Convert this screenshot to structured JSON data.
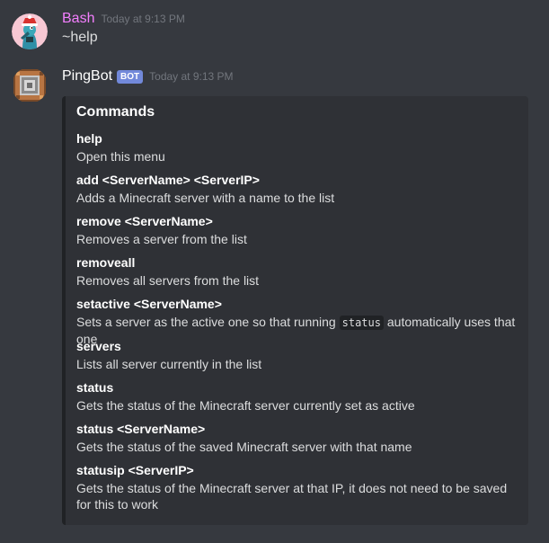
{
  "messages": [
    {
      "username": "Bash",
      "username_color": "#f47fff",
      "timestamp": "Today at 9:13 PM",
      "text": "~help"
    },
    {
      "username": "PingBot",
      "username_color": "#ffffff",
      "bot_tag": "BOT",
      "timestamp": "Today at 9:13 PM"
    }
  ],
  "embed": {
    "title": "Commands",
    "fields": [
      {
        "name": "help",
        "value": "Open this menu"
      },
      {
        "name": "add <ServerName> <ServerIP>",
        "value": "Adds a Minecraft server with a name to the list"
      },
      {
        "name": "remove <ServerName>",
        "value": "Removes a server from the list"
      },
      {
        "name": "removeall",
        "value": "Removes all servers from the list"
      },
      {
        "name": "setactive <ServerName>",
        "value_before": "Sets a server as the active one so that running",
        "value_code": "status",
        "value_after": "automatically uses that one"
      },
      {
        "name": "servers",
        "value": "Lists all server currently in the list"
      },
      {
        "name": "status",
        "value": "Gets the status of the Minecraft server currently set as active"
      },
      {
        "name": "status <ServerName>",
        "value": "Gets the status of the saved Minecraft server with that name"
      },
      {
        "name": "statusip <ServerIP>",
        "value": "Gets the status of the Minecraft server at that IP, it does not need to be saved for this to work"
      }
    ]
  },
  "colors": {
    "background": "#36393f",
    "embed_background": "#2f3136",
    "embed_border": "#202225",
    "bot_tag": "#7289da"
  },
  "icons": {
    "user_avatar": "platypus-avatar",
    "bot_avatar": "command-block-avatar"
  }
}
